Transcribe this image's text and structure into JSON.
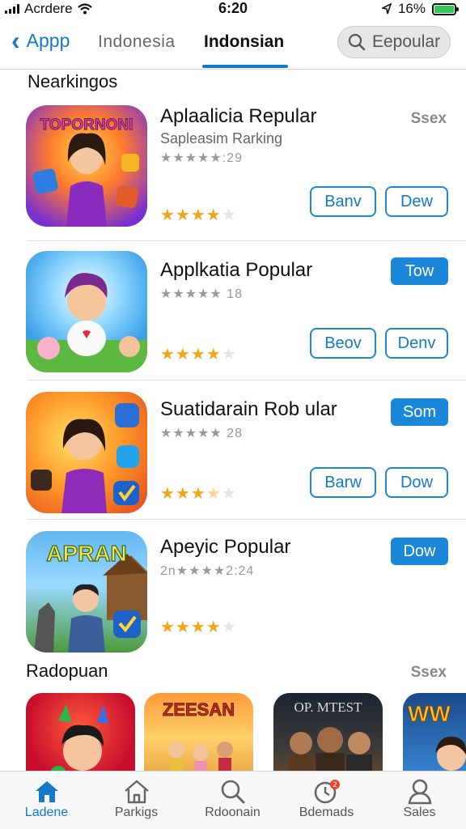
{
  "status_bar": {
    "carrier": "Acrdere",
    "time": "6:20",
    "battery": "16%"
  },
  "header": {
    "back_label": "Appp",
    "tabs": [
      {
        "label": "Indonesia",
        "active": false
      },
      {
        "label": "Indonsian",
        "active": true
      }
    ],
    "search": {
      "placeholder": "Eepoular"
    }
  },
  "section_top": {
    "title": "Nearkingos"
  },
  "apps": [
    {
      "name": "Aplaalicia Repular",
      "subtitle": "Sapleasim Rarking",
      "rating_count": ":29",
      "stars": 4,
      "see": "Ssex",
      "buttons": [
        {
          "label": "Banv",
          "style": "outline"
        },
        {
          "label": "Dew",
          "style": "outline"
        }
      ],
      "icon_text": "TOPORNONI"
    },
    {
      "name": "Applkatia Popular",
      "rating_count": "18",
      "stars": 4,
      "buttons": [
        {
          "label": "Tow",
          "style": "fill"
        },
        {
          "label": "Beov",
          "style": "outline"
        },
        {
          "label": "Denv",
          "style": "outline"
        }
      ]
    },
    {
      "name": "Suatidarain Rob ular",
      "rating_count": "28",
      "stars": 3.5,
      "buttons": [
        {
          "label": "Som",
          "style": "fill"
        },
        {
          "label": "Barw",
          "style": "outline"
        },
        {
          "label": "Dow",
          "style": "outline"
        }
      ]
    },
    {
      "name": "Apeyic Popular",
      "rating_prefix": "2n",
      "rating_count": "2:24",
      "stars": 4,
      "buttons": [
        {
          "label": "Dow",
          "style": "fill"
        }
      ],
      "icon_text": "APRAN"
    }
  ],
  "section_bottom": {
    "title": "Radopuan",
    "see": "Ssex",
    "shelf": [
      {
        "icon_text": ""
      },
      {
        "icon_text": "ZEESAN"
      },
      {
        "icon_text": "OP. MTEST"
      },
      {
        "icon_text": "WW"
      }
    ]
  },
  "tab_bar": [
    {
      "label": "Ladene",
      "icon": "home-icon",
      "active": true
    },
    {
      "label": "Parkigs",
      "icon": "store-icon",
      "active": false
    },
    {
      "label": "Rdoonain",
      "icon": "search-icon",
      "active": false
    },
    {
      "label": "Bdemads",
      "icon": "updates-icon",
      "active": false
    },
    {
      "label": "Sales",
      "icon": "person-icon",
      "active": false
    }
  ],
  "colors": {
    "accent": "#1479c7",
    "star": "#f2a516",
    "button_fill": "#1a87d9"
  }
}
